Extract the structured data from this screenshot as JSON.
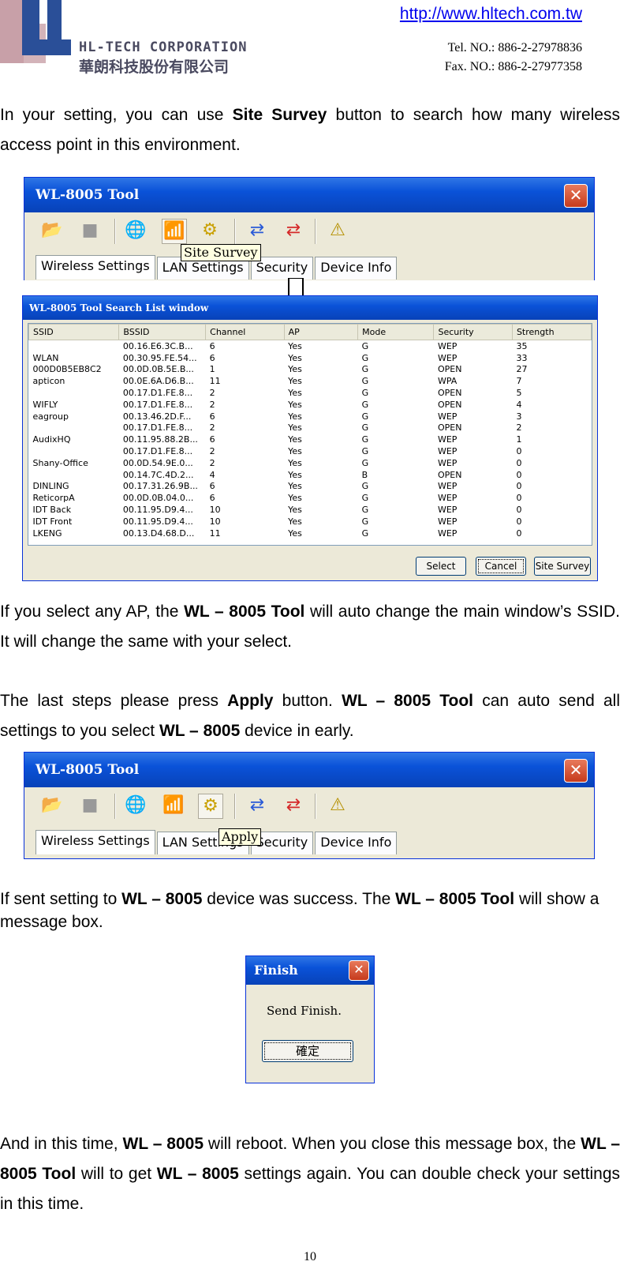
{
  "header": {
    "logo_text": "HL-TECH CORPORATION",
    "logo_chinese": "華朗科技股份有限公司",
    "website": "http://www.hltech.com.tw",
    "tel": "Tel. NO.: 886-2-27978836",
    "fax": "Fax. NO.: 886-2-27977358"
  },
  "para1": {
    "a": "In your setting, you can use ",
    "b": "Site Survey",
    "c": " button to search how many wireless access point in this environment."
  },
  "tool1": {
    "title": "WL-8005 Tool",
    "tooltip": "Site Survey",
    "tabs": [
      "Wireless Settings",
      "LAN Settings",
      "Security",
      "Device Info"
    ]
  },
  "search": {
    "title": "WL-8005 Tool Search List window",
    "columns": [
      "SSID",
      "BSSID",
      "Channel",
      "AP",
      "Mode",
      "Security",
      "Strength"
    ],
    "rows": [
      [
        "",
        "00.16.E6.3C.B...",
        "6",
        "Yes",
        "G",
        "WEP",
        "35"
      ],
      [
        "WLAN",
        "00.30.95.FE.54...",
        "6",
        "Yes",
        "G",
        "WEP",
        "33"
      ],
      [
        "000D0B5EB8C2",
        "00.0D.0B.5E.B...",
        "1",
        "Yes",
        "G",
        "OPEN",
        "27"
      ],
      [
        "apticon",
        "00.0E.6A.D6.B...",
        "11",
        "Yes",
        "G",
        "WPA",
        "7"
      ],
      [
        "",
        "00.17.D1.FE.8...",
        "2",
        "Yes",
        "G",
        "OPEN",
        "5"
      ],
      [
        "WIFLY",
        "00.17.D1.FE.8...",
        "2",
        "Yes",
        "G",
        "OPEN",
        "4"
      ],
      [
        "eagroup",
        "00.13.46.2D.F...",
        "6",
        "Yes",
        "G",
        "WEP",
        "3"
      ],
      [
        "",
        "00.17.D1.FE.8...",
        "2",
        "Yes",
        "G",
        "OPEN",
        "2"
      ],
      [
        "AudixHQ",
        "00.11.95.88.2B...",
        "6",
        "Yes",
        "G",
        "WEP",
        "1"
      ],
      [
        "",
        "00.17.D1.FE.8...",
        "2",
        "Yes",
        "G",
        "WEP",
        "0"
      ],
      [
        "Shany-Office",
        "00.0D.54.9E.0...",
        "2",
        "Yes",
        "G",
        "WEP",
        "0"
      ],
      [
        "",
        "00.14.7C.4D.2...",
        "4",
        "Yes",
        "B",
        "OPEN",
        "0"
      ],
      [
        "DINLING",
        "00.17.31.26.9B...",
        "6",
        "Yes",
        "G",
        "WEP",
        "0"
      ],
      [
        "ReticorpA",
        "00.0D.0B.04.0...",
        "6",
        "Yes",
        "G",
        "WEP",
        "0"
      ],
      [
        "IDT Back",
        "00.11.95.D9.4...",
        "10",
        "Yes",
        "G",
        "WEP",
        "0"
      ],
      [
        "IDT Front",
        "00.11.95.D9.4...",
        "10",
        "Yes",
        "G",
        "WEP",
        "0"
      ],
      [
        "LKENG",
        "00.13.D4.68.D...",
        "11",
        "Yes",
        "G",
        "WEP",
        "0"
      ]
    ],
    "buttons": {
      "select": "Select",
      "cancel": "Cancel",
      "site_survey": "Site Survey"
    }
  },
  "para2": {
    "a": "If you select any AP, the ",
    "b": "WL – 8005 Tool",
    "c": " will auto change the main window’s SSID. It will change the same with your select."
  },
  "para3": {
    "a": "The last steps please press ",
    "b": "Apply",
    "c": " button. ",
    "d": "WL – 8005 Tool",
    "e": " can auto send all settings to you select ",
    "f": "WL – 8005",
    "g": " device in early."
  },
  "tool2": {
    "title": "WL-8005 Tool",
    "tooltip": "Apply",
    "tabs": [
      "Wireless Settings",
      "LAN Settings",
      "Security",
      "Device Info"
    ]
  },
  "para4": {
    "a": "If sent setting to ",
    "b": "WL – 8005",
    "c": " device was success. The ",
    "d": "WL – 8005 Tool",
    "e": " will show a message box."
  },
  "finish": {
    "title": "Finish",
    "message": "Send Finish.",
    "ok": "確定"
  },
  "para5": {
    "a": "And in this time, ",
    "b": "WL – 8005",
    "c": " will reboot. When you close this message box, the ",
    "d": "WL – 8005 Tool",
    "e": " will to get ",
    "f": "WL – 8005",
    "g": " settings again. You can double check your settings in this time."
  },
  "page_number": "10"
}
